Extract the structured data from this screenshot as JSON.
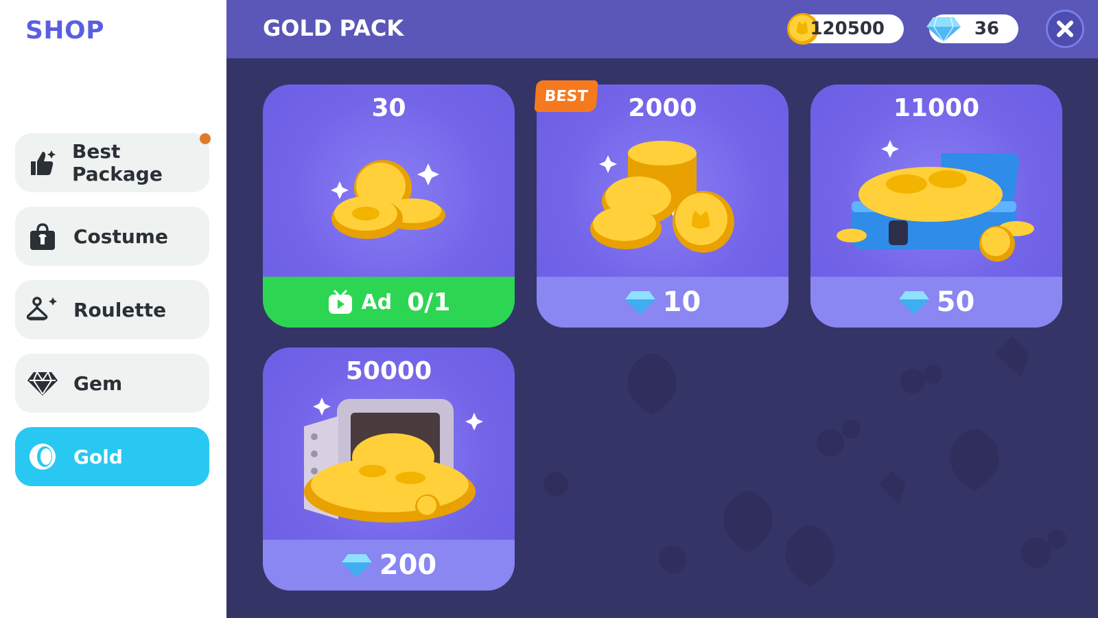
{
  "sidebar": {
    "title": "SHOP",
    "items": [
      {
        "label": "Best Package",
        "icon": "thumbs-up-sparkle-icon",
        "has_notification": true
      },
      {
        "label": "Costume",
        "icon": "shopping-bag-icon"
      },
      {
        "label": "Roulette",
        "icon": "hanger-sparkle-icon"
      },
      {
        "label": "Gem",
        "icon": "gem-icon"
      },
      {
        "label": "Gold",
        "icon": "gold-coin-icon",
        "active": true
      }
    ]
  },
  "header": {
    "title": "GOLD PACK",
    "gold_balance": "120500",
    "gem_balance": "36",
    "close_icon": "close-icon"
  },
  "products": [
    {
      "amount": "30",
      "art": "small-coin-pile",
      "price_type": "ad",
      "ad_label": "Ad",
      "ad_count": "0/1"
    },
    {
      "amount": "2000",
      "art": "coin-stack",
      "price_type": "gem",
      "price": "10",
      "badge": "BEST"
    },
    {
      "amount": "11000",
      "art": "coin-chest",
      "price_type": "gem",
      "price": "50"
    },
    {
      "amount": "50000",
      "art": "coin-safe",
      "price_type": "gem",
      "price": "200"
    }
  ],
  "colors": {
    "accent": "#5a5fe0",
    "active_nav": "#29c8f2",
    "header_bg": "#5a57b8",
    "panel_bg": "#353467",
    "card_bg": "#7364e8",
    "ad_green": "#2cd652",
    "badge_orange": "#f57a1f"
  }
}
